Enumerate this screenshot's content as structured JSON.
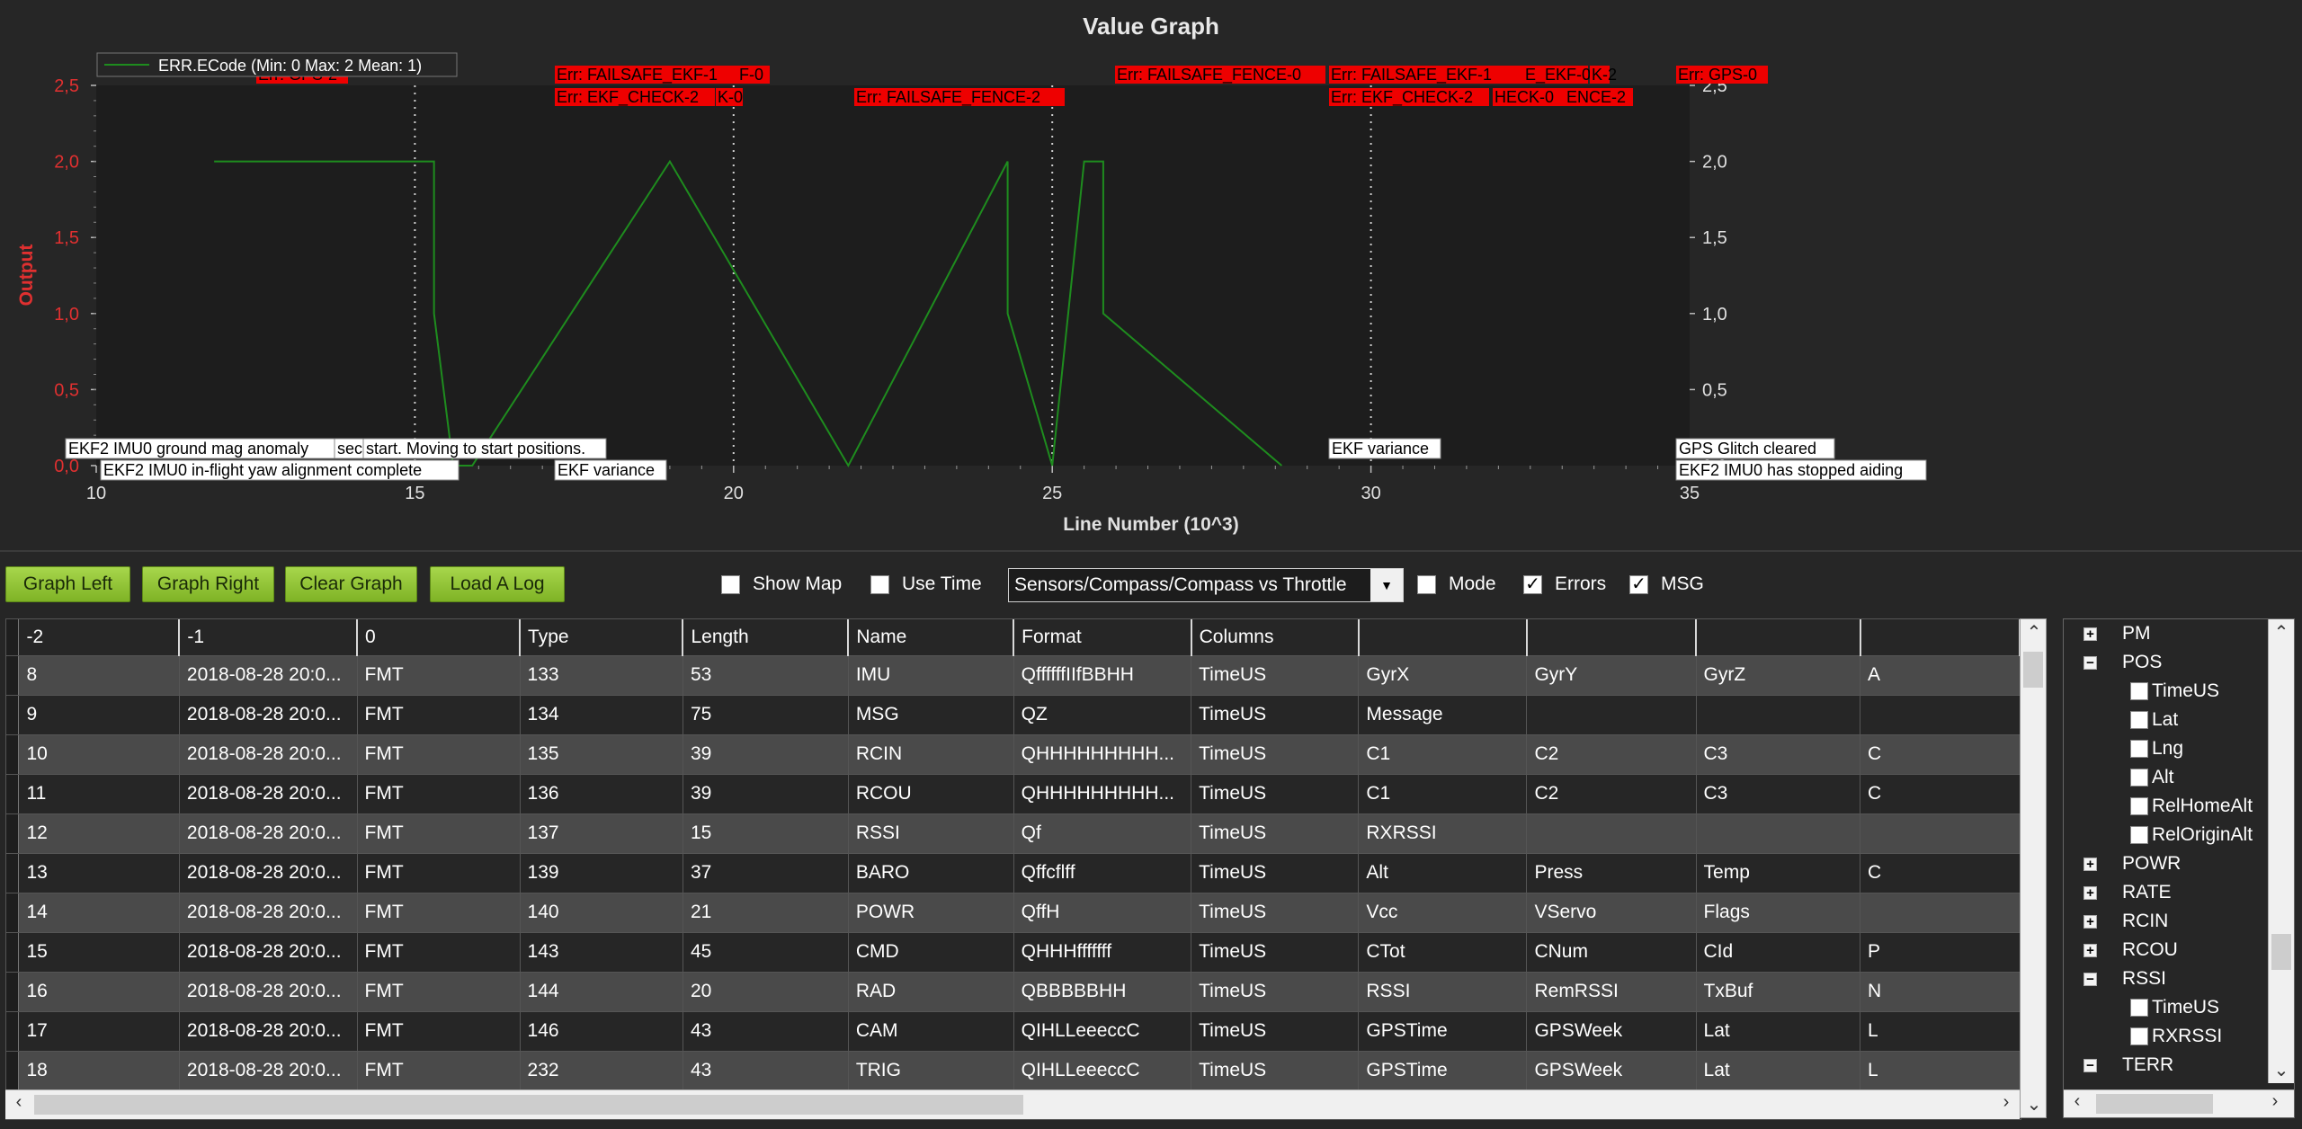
{
  "graph": {
    "title": "Value Graph",
    "legend_label": "ERR.ECode (Min: 0 Max: 2 Mean: 1)",
    "series_color": "#1e8c1e",
    "ylabel": "Output",
    "xlabel": "Line Number (10^3)",
    "yticks": [
      "0,0",
      "0,5",
      "1,0",
      "1,5",
      "2,0",
      "2,5"
    ],
    "xticks": [
      "10",
      "15",
      "20",
      "25",
      "30",
      "35"
    ],
    "error_labels": [
      "Err: GPS-2",
      "Err: FAILSAFE_EKF-1",
      "F-0",
      "Err: EKF_CHECK-2",
      "K-0",
      "Err: FAILSAFE_FENCE-2",
      "Err: FAILSAFE_FENCE-0",
      "Err: FAILSAFE_EKF-1",
      "E_EKF-0",
      "K-2",
      "Err: EKF_CHECK-2",
      "HECK-0",
      "ENCE-2",
      "Err: GPS-0"
    ],
    "msg_labels": [
      "EKF2 IMU0 ground mag anomaly",
      "sec",
      "start. Moving to start positions.",
      "EKF2 IMU0 in-flight yaw alignment complete",
      "EKF variance",
      "EKF variance",
      "GPS Glitch cleared",
      "EKF2 IMU0 has stopped aiding"
    ]
  },
  "chart_data": {
    "type": "line",
    "x": [
      11.85,
      15.3,
      15.3,
      15.6,
      15.9,
      19.0,
      21.8,
      24.3,
      24.3,
      25.0,
      25.5,
      25.8,
      25.8,
      28.6,
      28.6
    ],
    "series": [
      {
        "name": "ERR.ECode (Min: 0 Max: 2 Mean: 1)",
        "values": [
          2,
          2,
          1,
          0,
          0,
          2,
          0,
          2,
          1,
          0,
          2,
          2,
          1,
          0,
          0
        ]
      }
    ],
    "xlabel": "Line Number (10^3)",
    "ylabel": "Output",
    "xlim": [
      10,
      35
    ],
    "ylim": [
      0,
      2.5
    ],
    "grid": true,
    "legend": "top-left"
  },
  "toolbar": {
    "graph_left": "Graph Left",
    "graph_right": "Graph Right",
    "clear_graph": "Clear Graph",
    "load_log": "Load A Log",
    "show_map": "Show Map",
    "use_time": "Use Time",
    "graph_select": "Sensors/Compass/Compass vs Throttle",
    "mode": "Mode",
    "errors": "Errors",
    "msg": "MSG",
    "show_map_checked": false,
    "use_time_checked": false,
    "mode_checked": false,
    "errors_checked": true,
    "msg_checked": true
  },
  "table": {
    "headers": [
      "-2",
      "-1",
      "0",
      "Type",
      "Length",
      "Name",
      "Format",
      "Columns",
      "",
      "",
      "",
      ""
    ],
    "rows": [
      [
        "8",
        "2018-08-28 20:0...",
        "FMT",
        "133",
        "53",
        "IMU",
        "QffffffIIfBBHH",
        "TimeUS",
        "GyrX",
        "GyrY",
        "GyrZ",
        "A"
      ],
      [
        "9",
        "2018-08-28 20:0...",
        "FMT",
        "134",
        "75",
        "MSG",
        "QZ",
        "TimeUS",
        "Message",
        "",
        "",
        ""
      ],
      [
        "10",
        "2018-08-28 20:0...",
        "FMT",
        "135",
        "39",
        "RCIN",
        "QHHHHHHHHH...",
        "TimeUS",
        "C1",
        "C2",
        "C3",
        "C"
      ],
      [
        "11",
        "2018-08-28 20:0...",
        "FMT",
        "136",
        "39",
        "RCOU",
        "QHHHHHHHHH...",
        "TimeUS",
        "C1",
        "C2",
        "C3",
        "C"
      ],
      [
        "12",
        "2018-08-28 20:0...",
        "FMT",
        "137",
        "15",
        "RSSI",
        "Qf",
        "TimeUS",
        "RXRSSI",
        "",
        "",
        ""
      ],
      [
        "13",
        "2018-08-28 20:0...",
        "FMT",
        "139",
        "37",
        "BARO",
        "Qffcflff",
        "TimeUS",
        "Alt",
        "Press",
        "Temp",
        "C"
      ],
      [
        "14",
        "2018-08-28 20:0...",
        "FMT",
        "140",
        "21",
        "POWR",
        "QffH",
        "TimeUS",
        "Vcc",
        "VServo",
        "Flags",
        ""
      ],
      [
        "15",
        "2018-08-28 20:0...",
        "FMT",
        "143",
        "45",
        "CMD",
        "QHHHfffffff",
        "TimeUS",
        "CTot",
        "CNum",
        "CId",
        "P"
      ],
      [
        "16",
        "2018-08-28 20:0...",
        "FMT",
        "144",
        "20",
        "RAD",
        "QBBBBBHH",
        "TimeUS",
        "RSSI",
        "RemRSSI",
        "TxBuf",
        "N"
      ],
      [
        "17",
        "2018-08-28 20:0...",
        "FMT",
        "146",
        "43",
        "CAM",
        "QIHLLeeeccC",
        "TimeUS",
        "GPSTime",
        "GPSWeek",
        "Lat",
        "L"
      ],
      [
        "18",
        "2018-08-28 20:0...",
        "FMT",
        "232",
        "43",
        "TRIG",
        "QIHLLeeeccC",
        "TimeUS",
        "GPSTime",
        "GPSWeek",
        "Lat",
        "L"
      ]
    ]
  },
  "tree": {
    "nodes": [
      {
        "label": "PM",
        "type": "plus"
      },
      {
        "label": "POS",
        "type": "minus"
      },
      {
        "label": "TimeUS",
        "type": "check"
      },
      {
        "label": "Lat",
        "type": "check"
      },
      {
        "label": "Lng",
        "type": "check"
      },
      {
        "label": "Alt",
        "type": "check"
      },
      {
        "label": "RelHomeAlt",
        "type": "check"
      },
      {
        "label": "RelOriginAlt",
        "type": "check"
      },
      {
        "label": "POWR",
        "type": "plus"
      },
      {
        "label": "RATE",
        "type": "plus"
      },
      {
        "label": "RCIN",
        "type": "plus"
      },
      {
        "label": "RCOU",
        "type": "plus"
      },
      {
        "label": "RSSI",
        "type": "minus"
      },
      {
        "label": "TimeUS",
        "type": "check"
      },
      {
        "label": "RXRSSI",
        "type": "check"
      },
      {
        "label": "TERR",
        "type": "minus"
      }
    ]
  }
}
